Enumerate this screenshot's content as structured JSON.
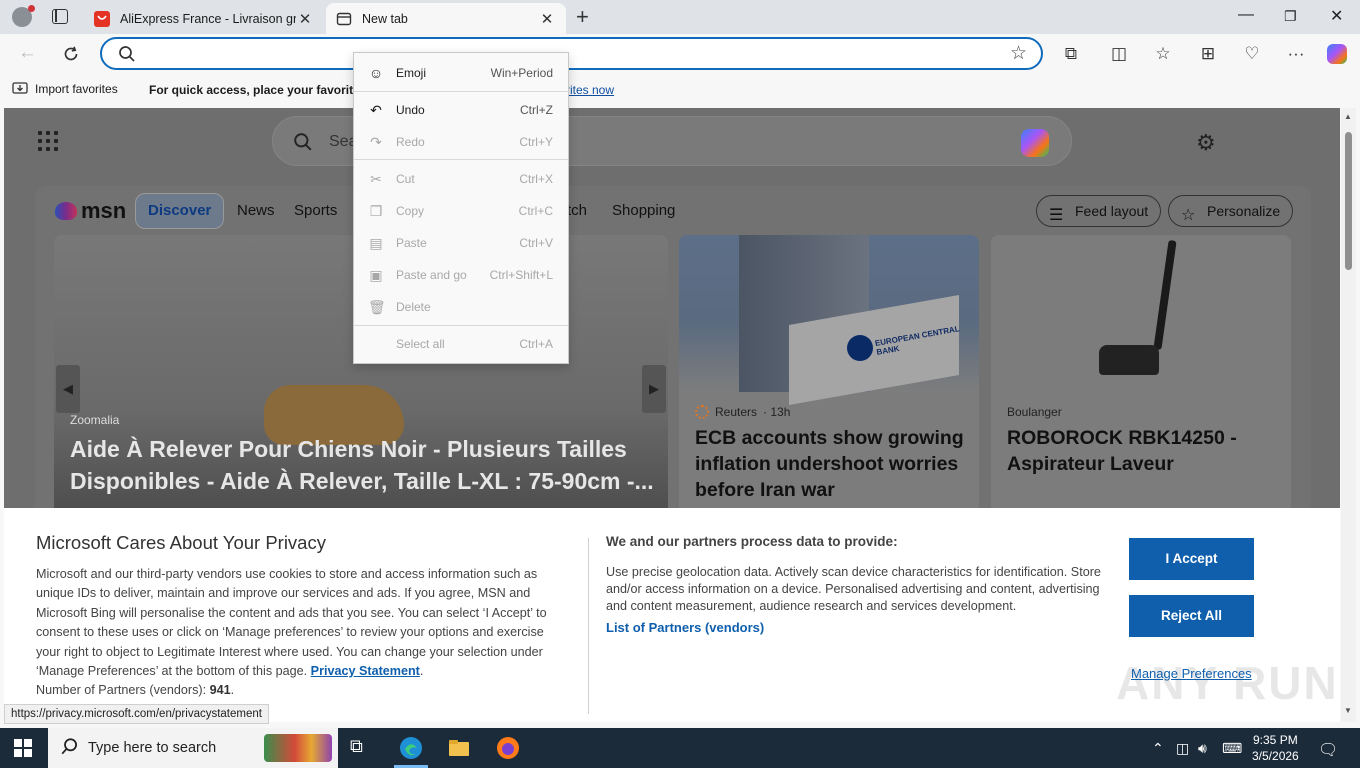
{
  "browser": {
    "tabs": [
      {
        "title": "AliExpress France - Livraison gratuite",
        "active": false
      },
      {
        "title": "New tab",
        "active": true
      }
    ],
    "address_value": "",
    "favorites_bar": {
      "import_label": "Import favorites",
      "hint_text": "For quick access, place your favorites",
      "link_text": "rites now"
    }
  },
  "page": {
    "search_placeholder": "Sea",
    "msn": {
      "logo_text": "msn",
      "nav": [
        "Discover",
        "News",
        "Sports",
        "tch",
        "Shopping"
      ],
      "feed_layout_label": "Feed layout",
      "personalize_label": "Personalize"
    },
    "hero": {
      "source": "Zoomalia",
      "headline": "Aide À Relever Pour Chiens Noir - Plusieurs Tailles Disponibles - Aide À Relever, Taille L-XL : 75-90cm -..."
    },
    "cards": [
      {
        "source": "Reuters",
        "age": "· 13h",
        "headline": "ECB accounts show growing inflation undershoot worries before Iran war",
        "image_text": "EUROPEAN CENTRAL BANK"
      },
      {
        "source": "Boulanger",
        "headline": "ROBOROCK RBK14250 - Aspirateur Laveur"
      }
    ]
  },
  "context_menu": {
    "items": [
      {
        "label": "Emoji",
        "shortcut": "Win+Period",
        "enabled": true,
        "icon": "emoji-icon"
      },
      {
        "label": "Undo",
        "shortcut": "Ctrl+Z",
        "enabled": true,
        "icon": "undo-icon"
      },
      {
        "label": "Redo",
        "shortcut": "Ctrl+Y",
        "enabled": false,
        "icon": "redo-icon"
      },
      {
        "label": "Cut",
        "shortcut": "Ctrl+X",
        "enabled": false,
        "icon": "cut-icon"
      },
      {
        "label": "Copy",
        "shortcut": "Ctrl+C",
        "enabled": false,
        "icon": "copy-icon"
      },
      {
        "label": "Paste",
        "shortcut": "Ctrl+V",
        "enabled": false,
        "icon": "paste-icon"
      },
      {
        "label": "Paste and go",
        "shortcut": "Ctrl+Shift+L",
        "enabled": false,
        "icon": "paste-go-icon"
      },
      {
        "label": "Delete",
        "shortcut": "",
        "enabled": false,
        "icon": "delete-icon"
      },
      {
        "label": "Select all",
        "shortcut": "Ctrl+A",
        "enabled": false,
        "icon": ""
      }
    ]
  },
  "privacy": {
    "title": "Microsoft Cares About Your Privacy",
    "body": "Microsoft and our third-party vendors use cookies to store and access information such as unique IDs to deliver, maintain and improve our services and ads. If you agree, MSN and Microsoft Bing will personalise the content and ads that you see. You can select ‘I Accept’ to consent to these uses or click on ‘Manage preferences’ to review your options and exercise your right to object to Legitimate Interest where used.  You can change your selection under ‘Manage Preferences’ at the bottom of this page.",
    "privacy_link": "Privacy Statement",
    "partners_count_label": "Number of Partners (vendors):",
    "partners_count": "941",
    "subheading": "We and our partners process data to provide:",
    "description": "Use precise geolocation data. Actively scan device characteristics for identification. Store and/or access information on a device. Personalised advertising and content, advertising and content measurement, audience research and services development.",
    "partners_link": "List of Partners (vendors)",
    "accept_label": "I Accept",
    "reject_label": "Reject All",
    "manage_label": "Manage Preferences",
    "watermark": "ANY RUN"
  },
  "status_url": "https://privacy.microsoft.com/en/privacystatement",
  "taskbar": {
    "search_placeholder": "Type here to search",
    "time": "9:35 PM",
    "date": "3/5/2026"
  },
  "colors": {
    "accent": "#0f5fad",
    "omnibox_border": "#0f6cbd",
    "taskbar": "#1c2b3a"
  }
}
